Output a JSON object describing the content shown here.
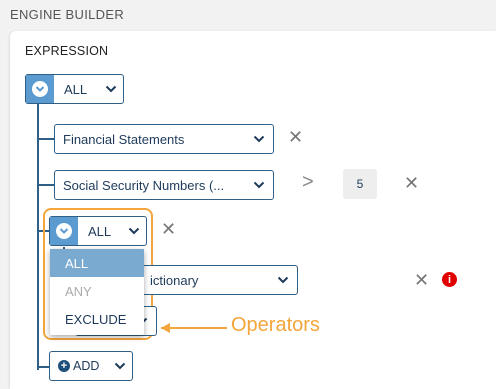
{
  "section_header": "ENGINE BUILDER",
  "panel_title": "EXPRESSION",
  "root_group": {
    "operator": "ALL"
  },
  "conditions": [
    {
      "label": "Financial Statements"
    },
    {
      "label": "Social Security Numbers (...",
      "comparator": ">",
      "value": "5"
    }
  ],
  "nested_group": {
    "operator": "ALL",
    "condition_label": "ictionary",
    "dropdown_options": [
      {
        "label": "ALL",
        "state": "selected"
      },
      {
        "label": "ANY",
        "state": "disabled"
      },
      {
        "label": "EXCLUDE",
        "state": "normal"
      }
    ]
  },
  "add_button": {
    "label": "ADD"
  },
  "annotation": {
    "text": "Operators",
    "color": "#f4a53c"
  },
  "icons": {
    "close": "close-icon",
    "chevron": "chevron-down-icon",
    "info": "info-icon",
    "plus": "plus-icon"
  },
  "colors": {
    "accent": "#5b9bd0",
    "border": "#2f5f87",
    "error": "#e00000",
    "highlight": "#f4a53c"
  }
}
